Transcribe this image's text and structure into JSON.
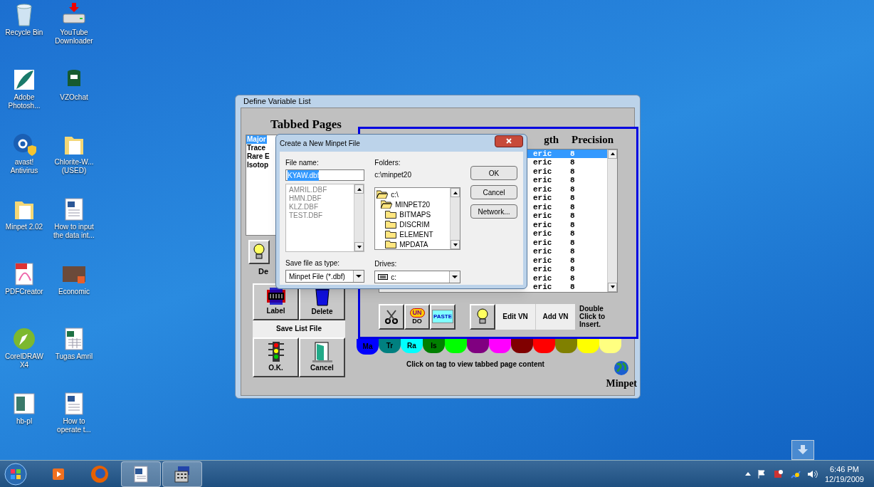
{
  "desktop_icons": [
    {
      "label": "Recycle Bin",
      "kind": "trash"
    },
    {
      "label": "YouTube Downloader",
      "kind": "drive"
    },
    {
      "label": "Adobe Photosh...",
      "kind": "feather"
    },
    {
      "label": "VZOchat",
      "kind": "chat"
    },
    {
      "label": "avast! Antivirus",
      "kind": "shield"
    },
    {
      "label": "Chlorite-W... (USED)",
      "kind": "folder"
    },
    {
      "label": "Minpet 2.02",
      "kind": "folder"
    },
    {
      "label": "How to input the data int...",
      "kind": "doc"
    },
    {
      "label": "PDFCreator",
      "kind": "pdf"
    },
    {
      "label": "Economic",
      "kind": "slides"
    },
    {
      "label": "CorelDRAW X4",
      "kind": "pen"
    },
    {
      "label": "Tugas Amril",
      "kind": "sheet"
    },
    {
      "label": "hb-pl",
      "kind": "web"
    },
    {
      "label": "How to operate t...",
      "kind": "doc"
    }
  ],
  "main_window": {
    "title": "Define Variable List",
    "tabbed_pages": {
      "title": "Tabbed Pages",
      "items": [
        {
          "label": "Major",
          "selected": true
        },
        {
          "label": "Trace",
          "selected": false
        },
        {
          "label": "Rare E",
          "selected": false
        },
        {
          "label": "Isotop",
          "selected": false
        }
      ]
    },
    "define_caption": "De",
    "buttons": [
      {
        "label": "Label",
        "kind": "data"
      },
      {
        "label": "Delete",
        "kind": "bin"
      }
    ],
    "save_button": "Save List File",
    "bottom_buttons": [
      {
        "label": "O.K.",
        "kind": "light"
      },
      {
        "label": "Cancel",
        "kind": "door"
      }
    ],
    "table": {
      "columns": [
        "gth",
        "Precision"
      ],
      "rows": [
        {
          "type": "eric",
          "length": "8",
          "selected": true
        },
        {
          "type": "eric",
          "length": "8",
          "selected": false
        },
        {
          "type": "eric",
          "length": "8",
          "selected": false
        },
        {
          "type": "eric",
          "length": "8",
          "selected": false
        },
        {
          "type": "eric",
          "length": "8",
          "selected": false
        },
        {
          "type": "eric",
          "length": "8",
          "selected": false
        },
        {
          "type": "eric",
          "length": "8",
          "selected": false
        },
        {
          "type": "eric",
          "length": "8",
          "selected": false
        },
        {
          "type": "eric",
          "length": "8",
          "selected": false
        },
        {
          "type": "eric",
          "length": "8",
          "selected": false
        },
        {
          "type": "eric",
          "length": "8",
          "selected": false
        },
        {
          "type": "eric",
          "length": "8",
          "selected": false
        },
        {
          "type": "eric",
          "length": "8",
          "selected": false
        },
        {
          "type": "eric",
          "length": "8",
          "selected": false
        },
        {
          "type": "eric",
          "length": "8",
          "selected": false
        },
        {
          "type": "eric",
          "length": "8",
          "selected": false
        }
      ]
    },
    "toolbar": {
      "undo_top": "UN",
      "undo_bottom": "DO",
      "paste": "PASTE",
      "edit": "Edit VN",
      "add": "Add VN",
      "hint": "Double Click to Insert."
    },
    "color_tabs": [
      {
        "label": "Ma",
        "color": "#0000ff",
        "selected": true
      },
      {
        "label": "Tr",
        "color": "#008080",
        "selected": false
      },
      {
        "label": "Ra",
        "color": "#00ffff",
        "selected": false
      },
      {
        "label": "Is",
        "color": "#008000",
        "selected": false
      },
      {
        "color": "#00ff00",
        "selected": false
      },
      {
        "color": "#800080",
        "selected": false
      },
      {
        "color": "#ff00ff",
        "selected": false
      },
      {
        "color": "#800000",
        "selected": false
      },
      {
        "color": "#ff0000",
        "selected": false
      },
      {
        "color": "#808000",
        "selected": false
      },
      {
        "color": "#ffff00",
        "selected": false
      },
      {
        "color": "#ffff80",
        "selected": false
      }
    ],
    "tab_hint": "Click on tag to view tabbed page content",
    "logo": "Minpet"
  },
  "dialog": {
    "title": "Create a New Minpet File",
    "file_name_label": "File name:",
    "file_name": "KYAW.dbf",
    "files": [
      "AMRIL.DBF",
      "HMN.DBF",
      "KLZ.DBF",
      "TEST.DBF"
    ],
    "folders_label": "Folders:",
    "folder_path": "c:\\minpet20",
    "folders": [
      {
        "label": "c:\\",
        "kind": "open",
        "children": [
          {
            "label": "MINPET20",
            "kind": "open",
            "children": [
              {
                "label": "BITMAPS",
                "kind": "closed"
              },
              {
                "label": "DISCRIM",
                "kind": "closed"
              },
              {
                "label": "ELEMENT",
                "kind": "closed"
              },
              {
                "label": "MPDATA",
                "kind": "closed"
              }
            ]
          }
        ]
      }
    ],
    "buttons": [
      "OK",
      "Cancel",
      "Network..."
    ],
    "type_label": "Save file as type:",
    "type_value": "Minpet File (*.dbf)",
    "drives_label": "Drives:",
    "drive_value": "c:"
  },
  "taskbar": {
    "apps": [
      {
        "kind": "media",
        "active": false
      },
      {
        "kind": "firefox",
        "active": false
      },
      {
        "kind": "word",
        "active": true
      },
      {
        "kind": "app",
        "active": true
      }
    ],
    "time": "6:46 PM",
    "date": "12/19/2009"
  }
}
